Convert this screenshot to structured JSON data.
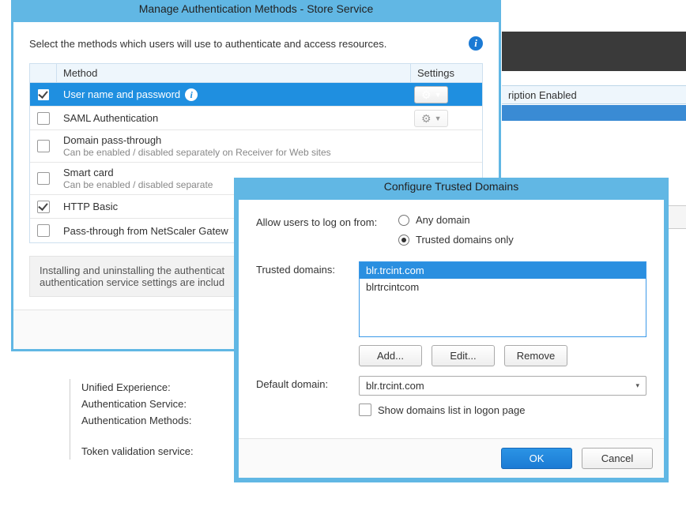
{
  "bg": {
    "header_cell": "ription Enabled",
    "labels": {
      "unified": "Unified Experience:",
      "auth_service": "Authentication Service:",
      "auth_methods": "Authentication Methods:",
      "token_validation": "Token validation service:"
    }
  },
  "main_dialog": {
    "title": "Manage Authentication Methods - Store Service",
    "description": "Select the methods which users will use to authenticate and access resources.",
    "columns": {
      "method": "Method",
      "settings": "Settings"
    },
    "rows": [
      {
        "checked": true,
        "selected": true,
        "title": "User name and password",
        "sub": "",
        "has_info": true,
        "has_settings": true,
        "settings_enabled": true
      },
      {
        "checked": false,
        "selected": false,
        "title": "SAML Authentication",
        "sub": "",
        "has_info": false,
        "has_settings": true,
        "settings_enabled": false
      },
      {
        "checked": false,
        "selected": false,
        "title": "Domain pass-through",
        "sub": "Can be enabled / disabled separately on Receiver for Web sites",
        "has_info": false,
        "has_settings": false
      },
      {
        "checked": false,
        "selected": false,
        "title": "Smart card",
        "sub": "Can be enabled / disabled separate",
        "has_info": false,
        "has_settings": false
      },
      {
        "checked": true,
        "selected": false,
        "title": "HTTP Basic",
        "sub": "",
        "has_info": false,
        "has_settings": false
      },
      {
        "checked": false,
        "selected": false,
        "title": "Pass-through from NetScaler Gatew",
        "sub": "",
        "has_info": false,
        "has_settings": false
      }
    ],
    "note": "Installing and uninstalling the authenticat\nauthentication service settings are includ"
  },
  "trust_dialog": {
    "title": "Configure Trusted Domains",
    "allow_label": "Allow users to log on from:",
    "radio_any": "Any domain",
    "radio_trusted": "Trusted domains only",
    "radio_selected": "trusted",
    "trusted_label": "Trusted domains:",
    "domains": [
      {
        "name": "blr.trcint.com",
        "selected": true
      },
      {
        "name": "blrtrcintcom",
        "selected": false
      }
    ],
    "buttons": {
      "add": "Add...",
      "edit": "Edit...",
      "remove": "Remove"
    },
    "default_label": "Default domain:",
    "default_value": "blr.trcint.com",
    "show_domains_label": "Show domains list in logon page",
    "show_domains_checked": false,
    "ok": "OK",
    "cancel": "Cancel"
  }
}
